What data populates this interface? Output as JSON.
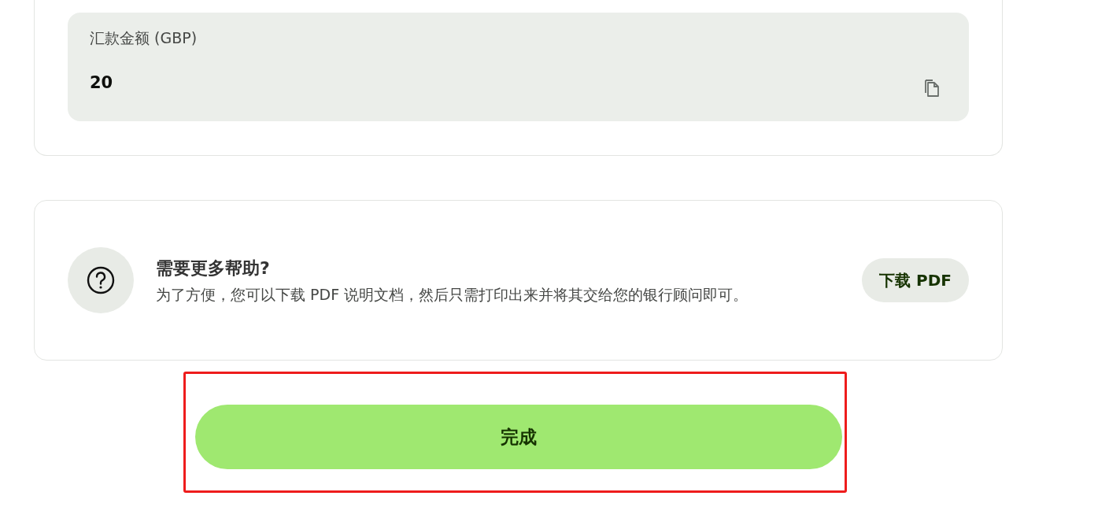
{
  "amount_card": {
    "label": "汇款金额 (GBP)",
    "value": "20"
  },
  "help_card": {
    "title": "需要更多帮助?",
    "text": "为了方便，您可以下载 PDF 说明文档，然后只需打印出来并将其交给您的银行顾问即可。",
    "button": "下载 PDF"
  },
  "done_button": {
    "label": "完成",
    "highlighted": true
  }
}
